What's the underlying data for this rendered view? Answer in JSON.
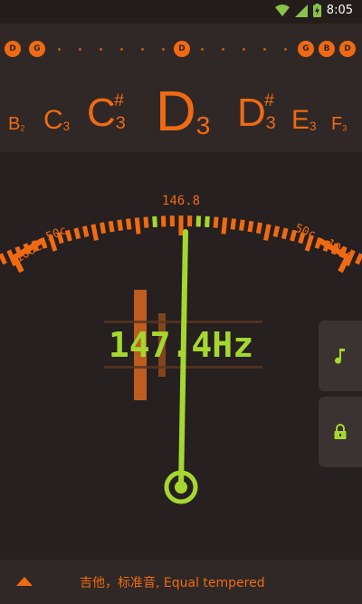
{
  "status_bar": {
    "time": "8:05",
    "icons": [
      "wifi-icon",
      "signal-icon",
      "battery-charging-icon"
    ]
  },
  "strings": {
    "left": [
      "D",
      "G"
    ],
    "center": "D",
    "right": [
      "G",
      "B",
      "D"
    ]
  },
  "notes": {
    "items": [
      {
        "letter": "B",
        "octave": "2",
        "sharp": ""
      },
      {
        "letter": "C",
        "octave": "3",
        "sharp": ""
      },
      {
        "letter": "C",
        "octave": "3",
        "sharp": "#"
      },
      {
        "letter": "D",
        "octave": "3",
        "sharp": ""
      },
      {
        "letter": "D",
        "octave": "3",
        "sharp": "#"
      },
      {
        "letter": "E",
        "octave": "3",
        "sharp": ""
      },
      {
        "letter": "F",
        "octave": "3",
        "sharp": ""
      }
    ],
    "selected_index": 3
  },
  "gauge": {
    "target_frequency": "146.8",
    "scale_labels": {
      "left_outer": "100c",
      "left_inner": "50c",
      "right_inner": "50c",
      "right_outer": "100c"
    },
    "frequency_readout": "147.4Hz",
    "cents_deviation": 7
  },
  "side_buttons": {
    "top_icon": "music-note-icon",
    "bottom_icon": "lock-icon"
  },
  "bottom_bar": {
    "preset": "吉他，标准音, Equal tempered",
    "expand_icon": "triangle-up-icon"
  },
  "colors": {
    "accent": "#f06a13",
    "needle": "#a6d72f",
    "background": "#262020"
  }
}
